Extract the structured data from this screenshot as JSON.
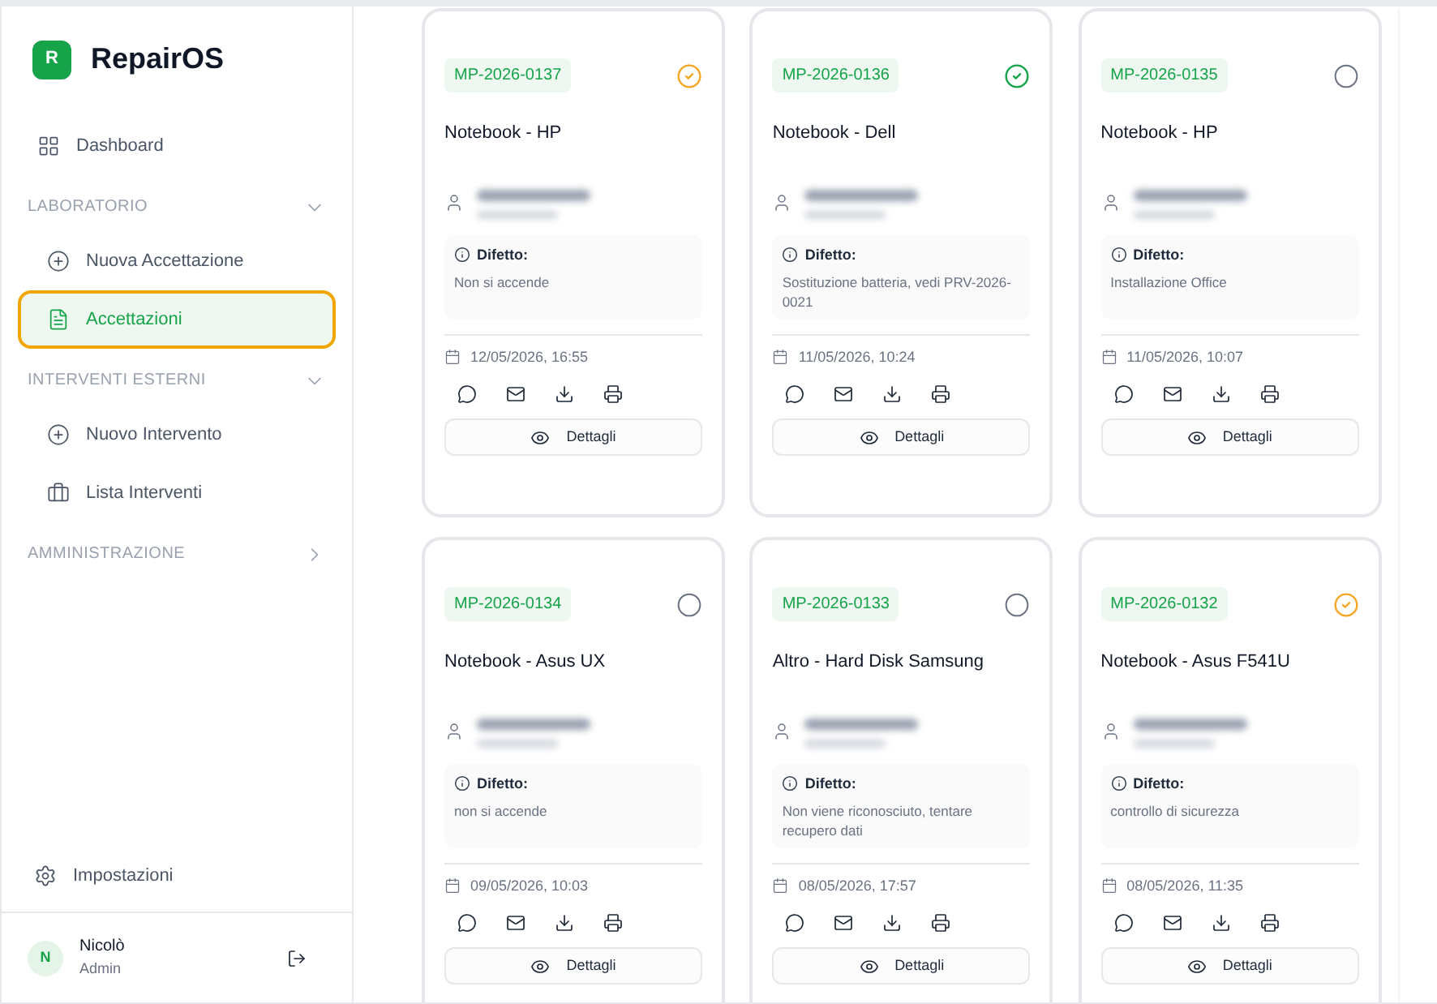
{
  "brand": {
    "logo_letter": "R",
    "name": "RepairOS"
  },
  "sidebar": {
    "items": [
      {
        "kind": "link",
        "label": "Dashboard",
        "selected": false
      },
      {
        "kind": "section",
        "label": "LABORATORIO",
        "expanded": true
      },
      {
        "kind": "link",
        "label": "Nuova Accettazione",
        "selected": false
      },
      {
        "kind": "link",
        "label": "Accettazioni",
        "selected": true
      },
      {
        "kind": "section",
        "label": "INTERVENTI ESTERNI",
        "expanded": true
      },
      {
        "kind": "link",
        "label": "Nuovo Intervento",
        "selected": false
      },
      {
        "kind": "link",
        "label": "Lista Interventi",
        "selected": false
      },
      {
        "kind": "section",
        "label": "AMMINISTRAZIONE",
        "expanded": false
      }
    ],
    "settings": "Impostazioni",
    "user": {
      "initial": "N",
      "name": "Nicolò",
      "role": "Admin"
    }
  },
  "cards": [
    {
      "code": "MP-2026-0137",
      "kind": "pending",
      "device": "Notebook - HP",
      "defect_label": "Difetto:",
      "defect": "Non si accende",
      "date": "12/05/2026, 16:55",
      "button": "Dettagli"
    },
    {
      "code": "MP-2026-0136",
      "kind": "done",
      "device": "Notebook - Dell",
      "defect_label": "Difetto:",
      "defect": "Sostituzione batteria, vedi PRV-2026-0021",
      "date": "11/05/2026, 10:24",
      "button": "Dettagli"
    },
    {
      "code": "MP-2026-0135",
      "kind": "open",
      "device": "Notebook - HP",
      "defect_label": "Difetto:",
      "defect": "Installazione Office",
      "date": "11/05/2026, 10:07",
      "button": "Dettagli"
    },
    {
      "code": "MP-2026-0134",
      "kind": "open",
      "device": "Notebook - Asus UX",
      "defect_label": "Difetto:",
      "defect": "non si accende",
      "date": "09/05/2026, 10:03",
      "button": "Dettagli"
    },
    {
      "code": "MP-2026-0133",
      "kind": "open",
      "device": "Altro - Hard Disk Samsung",
      "defect_label": "Difetto:",
      "defect": "Non viene riconosciuto, tentare recupero dati",
      "date": "08/05/2026, 17:57",
      "button": "Dettagli"
    },
    {
      "code": "MP-2026-0132",
      "kind": "pending",
      "device": "Notebook - Asus F541U",
      "defect_label": "Difetto:",
      "defect": "controllo di sicurezza",
      "date": "08/05/2026, 11:35",
      "button": "Dettagli"
    }
  ]
}
